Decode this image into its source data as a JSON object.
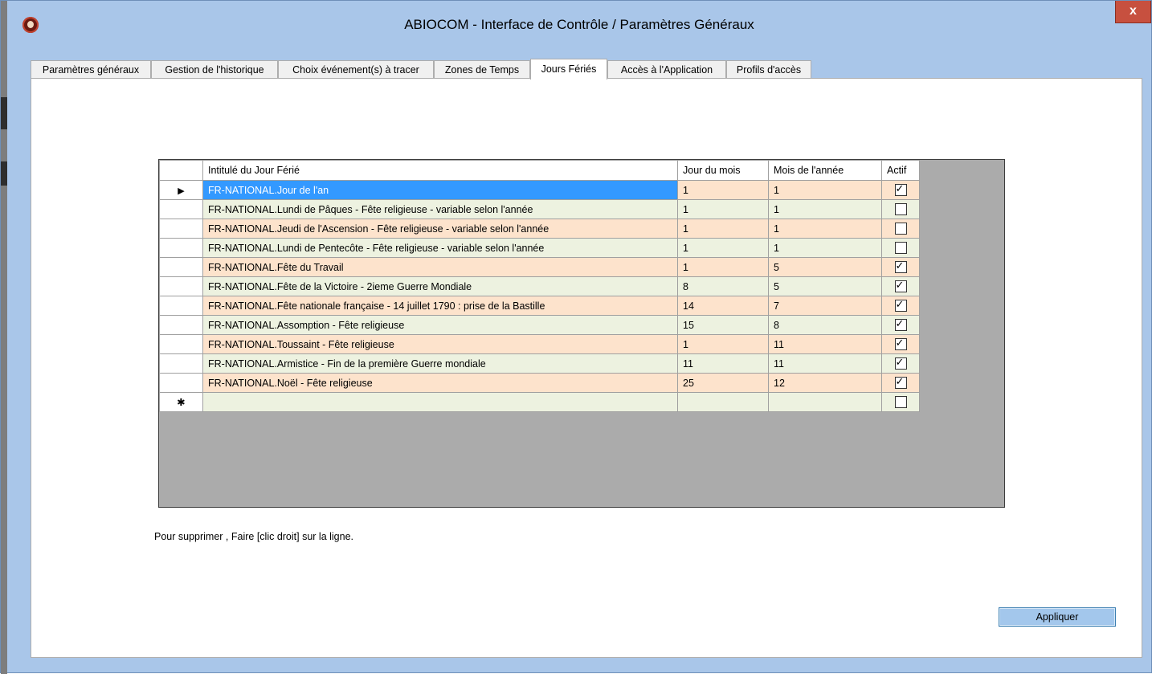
{
  "window": {
    "title": "ABIOCOM - Interface de Contrôle / Paramètres Généraux",
    "close_label": "x"
  },
  "tabs": [
    {
      "label": "Paramètres généraux",
      "active": false
    },
    {
      "label": "Gestion de l'historique",
      "active": false
    },
    {
      "label": "Choix événement(s) à tracer",
      "active": false
    },
    {
      "label": "Zones de Temps",
      "active": false
    },
    {
      "label": "Jours Fériés",
      "active": true
    },
    {
      "label": "Accès à l'Application",
      "active": false
    },
    {
      "label": "Profils d'accès",
      "active": false
    }
  ],
  "grid": {
    "columns": [
      "Intitulé du Jour Férié",
      "Jour du mois",
      "Mois de l'année",
      "Actif"
    ],
    "current_row_marker": "▶",
    "new_row_marker": "✱",
    "rows": [
      {
        "label": "FR-NATIONAL.Jour de l'an",
        "day": "1",
        "month": "1",
        "active": true
      },
      {
        "label": "FR-NATIONAL.Lundi de Pâques - Fête religieuse - variable selon l'année",
        "day": "1",
        "month": "1",
        "active": false
      },
      {
        "label": "FR-NATIONAL.Jeudi de l'Ascension - Fête religieuse - variable selon l'année",
        "day": "1",
        "month": "1",
        "active": false
      },
      {
        "label": "FR-NATIONAL.Lundi de Pentecôte - Fête religieuse - variable selon l'année",
        "day": "1",
        "month": "1",
        "active": false
      },
      {
        "label": "FR-NATIONAL.Fête du Travail",
        "day": "1",
        "month": "5",
        "active": true
      },
      {
        "label": "FR-NATIONAL.Fête de la Victoire - 2ieme Guerre Mondiale",
        "day": "8",
        "month": "5",
        "active": true
      },
      {
        "label": "FR-NATIONAL.Fête nationale française - 14 juillet 1790 : prise de la Bastille",
        "day": "14",
        "month": "7",
        "active": true
      },
      {
        "label": "FR-NATIONAL.Assomption - Fête religieuse",
        "day": "15",
        "month": "8",
        "active": true
      },
      {
        "label": "FR-NATIONAL.Toussaint - Fête religieuse",
        "day": "1",
        "month": "11",
        "active": true
      },
      {
        "label": "FR-NATIONAL.Armistice - Fin de la première Guerre mondiale",
        "day": "11",
        "month": "11",
        "active": true
      },
      {
        "label": "FR-NATIONAL.Noël - Fête religieuse",
        "day": "25",
        "month": "12",
        "active": true
      }
    ]
  },
  "note": "Pour supprimer , Faire [clic droit] sur la ligne.",
  "apply_label": "Appliquer",
  "colors": {
    "window_frame": "#a9c6e9",
    "row_even": "#edf2e0",
    "row_odd": "#fde3cc",
    "selection": "#3399ff",
    "grid_background": "#ababab",
    "close_button": "#c7503f"
  }
}
